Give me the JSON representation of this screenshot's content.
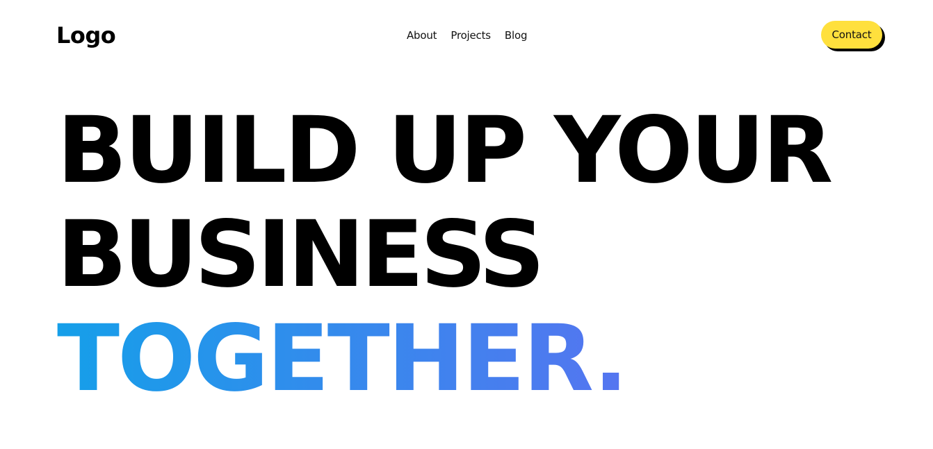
{
  "header": {
    "logo": "Logo",
    "nav": [
      {
        "label": "About"
      },
      {
        "label": "Projects"
      },
      {
        "label": "Blog"
      }
    ],
    "contact_label": "Contact"
  },
  "hero": {
    "line1": "BUILD UP YOUR",
    "line2": "BUSINESS",
    "line3": "TOGETHER."
  },
  "colors": {
    "accent_yellow": "#ffe03d",
    "gradient_start": "#159fe9",
    "gradient_end": "#5575f0",
    "text": "#000000",
    "background": "#ffffff"
  }
}
